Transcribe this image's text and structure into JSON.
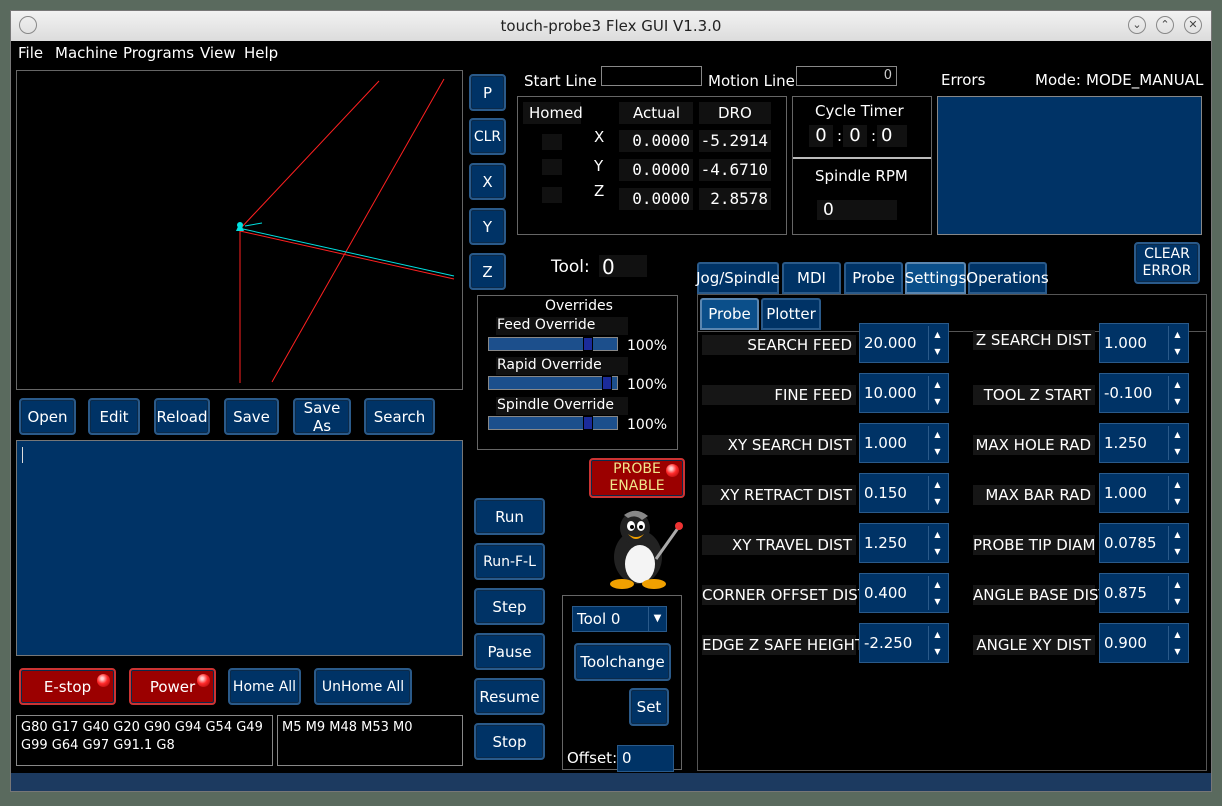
{
  "window": {
    "title": "touch-probe3 Flex GUI V1.3.0"
  },
  "menu": [
    "File",
    "Machine",
    "Programs",
    "View",
    "Help"
  ],
  "plot_buttons": [
    "P",
    "CLR",
    "X",
    "Y",
    "Z"
  ],
  "file_buttons": [
    "Open",
    "Edit",
    "Reload",
    "Save",
    "Save As",
    "Search"
  ],
  "control_buttons": [
    "E-stop",
    "Power",
    "Home All",
    "UnHome All"
  ],
  "gcodes": "G80 G17 G40 G20 G90 G94 G54 G49 G99 G64 G97 G91.1 G8",
  "mcodes": "M5 M9 M48 M53 M0",
  "run_buttons": [
    "Run",
    "Run-F-L",
    "Step",
    "Pause",
    "Resume",
    "Stop"
  ],
  "start_line": {
    "label": "Start Line",
    "value": ""
  },
  "motion_line": {
    "label": "Motion Line",
    "value": "0"
  },
  "dro": {
    "headers": {
      "homed": "Homed",
      "actual": "Actual",
      "dro": "DRO"
    },
    "axes": [
      {
        "axis": "X",
        "actual": "0.0000",
        "dro": "-5.2914"
      },
      {
        "axis": "Y",
        "actual": "0.0000",
        "dro": "-4.6710"
      },
      {
        "axis": "Z",
        "actual": "0.0000",
        "dro": "2.8578"
      }
    ]
  },
  "cycle_timer": {
    "label": "Cycle Timer",
    "h": "0",
    "m": "0",
    "s": "0"
  },
  "spindle_rpm": {
    "label": "Spindle RPM",
    "value": "0"
  },
  "errors": {
    "label": "Errors"
  },
  "mode": {
    "label": "Mode:",
    "value": "MODE_MANUAL"
  },
  "clear_error": "CLEAR ERROR",
  "tool": {
    "label": "Tool:",
    "value": "0"
  },
  "overrides": {
    "title": "Overrides",
    "items": [
      {
        "label": "Feed Override",
        "value": "100%",
        "level": 0.78
      },
      {
        "label": "Rapid Override",
        "value": "100%",
        "level": 0.92
      },
      {
        "label": "Spindle Override",
        "value": "100%",
        "level": 0.78
      }
    ]
  },
  "probe_enable": "PROBE ENABLE",
  "tool_select": "Tool 0",
  "toolchange": "Toolchange",
  "set_button": "Set",
  "offset": {
    "label": "Offset:",
    "value": "0"
  },
  "tabs": [
    "Jog/Spindle",
    "MDI",
    "Probe",
    "Settings",
    "Operations"
  ],
  "subtabs": [
    "Probe",
    "Plotter"
  ],
  "probe_left": [
    {
      "label": "SEARCH FEED",
      "value": "20.000"
    },
    {
      "label": "FINE  FEED",
      "value": "10.000"
    },
    {
      "label": "XY SEARCH DIST",
      "value": "1.000"
    },
    {
      "label": "XY RETRACT DIST",
      "value": "0.150"
    },
    {
      "label": "XY TRAVEL DIST",
      "value": "1.250"
    },
    {
      "label": "CORNER OFFSET DIST",
      "value": "0.400"
    },
    {
      "label": "EDGE Z SAFE HEIGHT",
      "value": "-2.250"
    }
  ],
  "probe_right": [
    {
      "label": "Z SEARCH DIST",
      "value": "1.000"
    },
    {
      "label": "TOOL Z START",
      "value": "-0.100"
    },
    {
      "label": "MAX HOLE RAD",
      "value": "1.250"
    },
    {
      "label": "MAX BAR RAD",
      "value": "1.000"
    },
    {
      "label": "PROBE TIP DIAM",
      "value": "0.0785"
    },
    {
      "label": "ANGLE BASE DIST",
      "value": "0.875"
    },
    {
      "label": "ANGLE XY DIST",
      "value": "0.900"
    }
  ],
  "colors": {
    "accent": "#003366",
    "button_border": "#2a5a8a",
    "estop": "#9b0000",
    "plot_red": "#ff2020",
    "plot_cyan": "#00e0e0"
  }
}
